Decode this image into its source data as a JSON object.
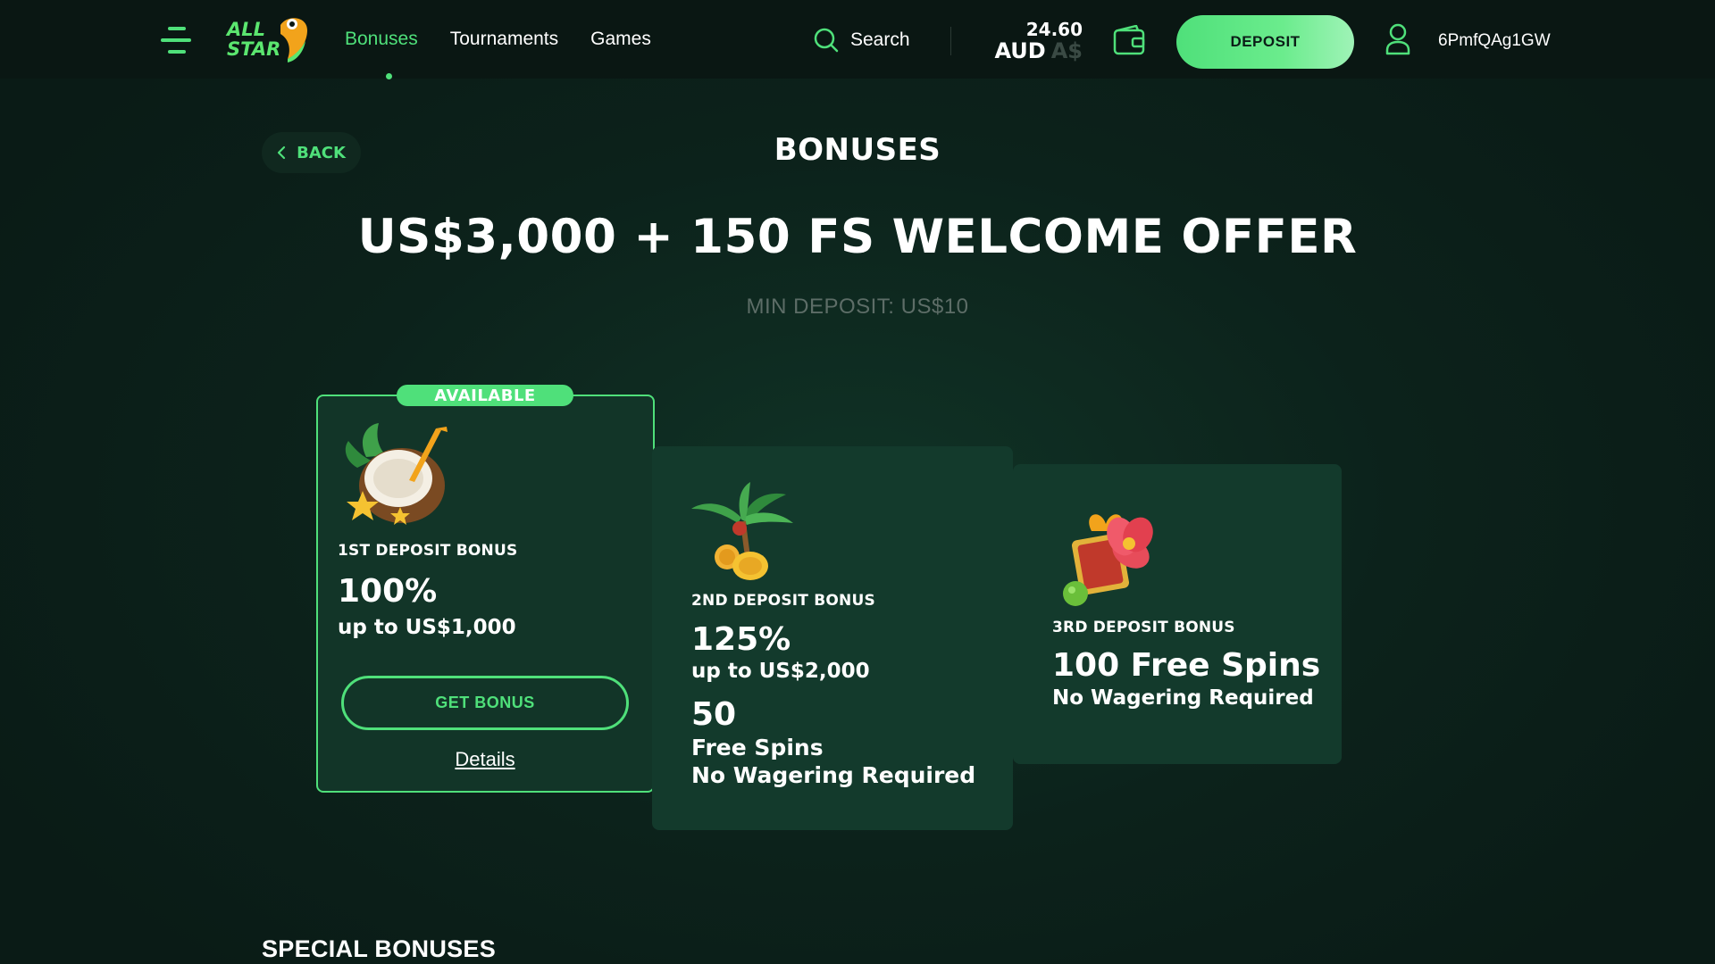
{
  "header": {
    "menu_icon": "hamburger-menu-icon",
    "logo_text_line1": "ALL",
    "logo_text_line2": "STAR",
    "nav": [
      {
        "label": "Bonuses",
        "active": true
      },
      {
        "label": "Tournaments",
        "active": false
      },
      {
        "label": "Games",
        "active": false
      }
    ],
    "search_label": "Search",
    "balance_amount": "24.60",
    "balance_currency": "AUD",
    "balance_symbol": "A$",
    "wallet_icon": "wallet-icon",
    "deposit_label": "DEPOSIT",
    "user_icon": "user-icon",
    "username": "6PmfQAg1GW"
  },
  "page": {
    "back_label": "BACK",
    "title": "BONUSES",
    "offer_title": "US$3,000 + 150 FS WELCOME OFFER",
    "min_deposit": "MIN DEPOSIT: US$10"
  },
  "cards": [
    {
      "badge": "AVAILABLE",
      "label": "1ST DEPOSIT BONUS",
      "percent": "100%",
      "up_to": "up to US$1,000",
      "button": "GET BONUS",
      "details": "Details",
      "illustration": "coconut-drink-icon"
    },
    {
      "label": "2ND DEPOSIT BONUS",
      "percent": "125%",
      "up_to": "up to US$2,000",
      "spins_count": "50",
      "spins_label": "Free Spins",
      "spins_note": "No Wagering Required",
      "illustration": "palm-coins-icon"
    },
    {
      "label": "3RD DEPOSIT BONUS",
      "spins_title": "100 Free Spins",
      "spins_note": "No Wagering Required",
      "illustration": "flower-gift-icon"
    }
  ],
  "special_bonuses_title": "SPECIAL BONUSES",
  "colors": {
    "accent": "#4fe07a",
    "background": "#0b1d17",
    "card": "#133a2c"
  }
}
